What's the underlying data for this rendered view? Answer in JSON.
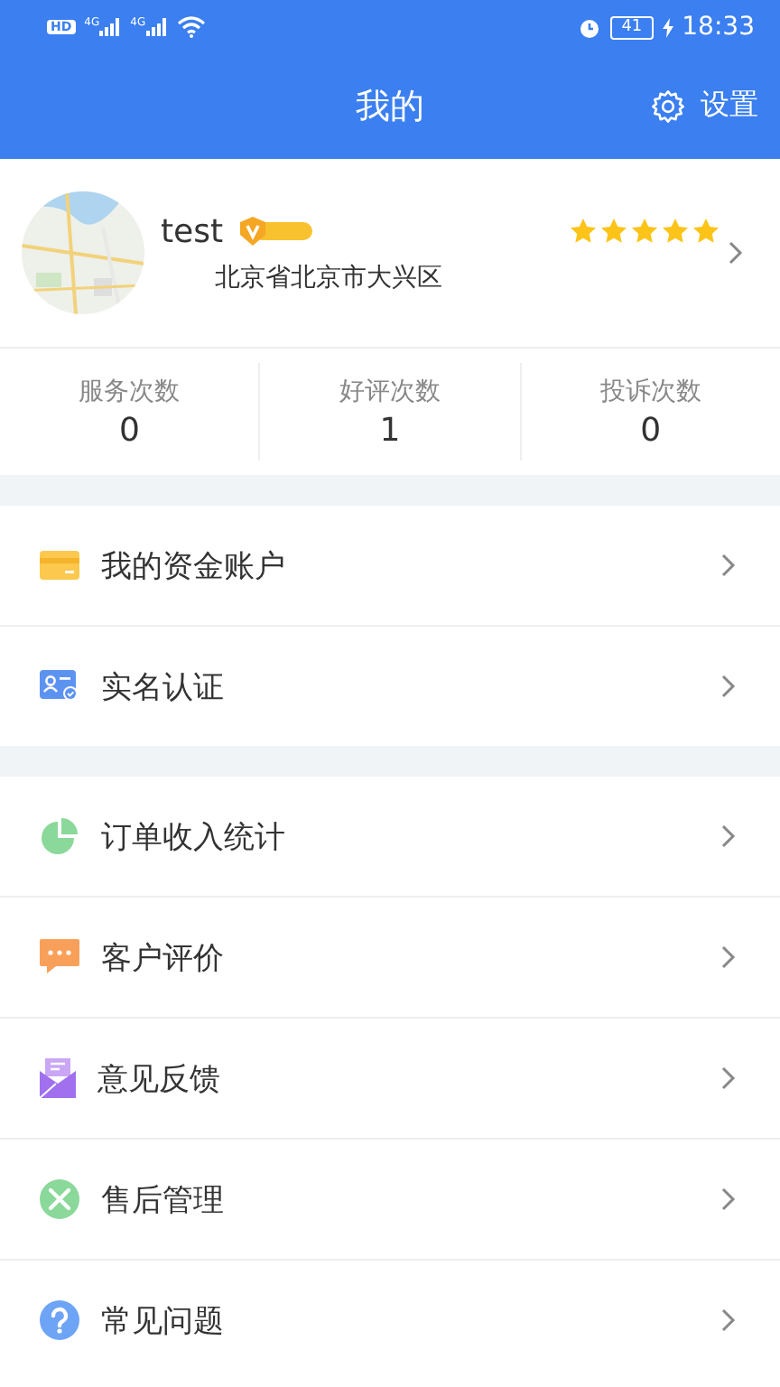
{
  "status_bar": {
    "hd": "HD",
    "signals": [
      "4G",
      "4G"
    ],
    "battery": "41",
    "time": "18:33"
  },
  "header": {
    "title": "我的",
    "settings": "设置"
  },
  "profile": {
    "name": "test",
    "verified": true,
    "stars": 5,
    "address": "北京省北京市大兴区"
  },
  "stats": [
    {
      "label": "服务次数",
      "value": "0"
    },
    {
      "label": "好评次数",
      "value": "1"
    },
    {
      "label": "投诉次数",
      "value": "0"
    }
  ],
  "menu_groups": [
    [
      {
        "kind": "wallet",
        "label": "我的资金账户"
      },
      {
        "kind": "idcard",
        "label": "实名认证"
      }
    ],
    [
      {
        "kind": "pie",
        "label": "订单收入统计"
      },
      {
        "kind": "chat",
        "label": "客户评价"
      },
      {
        "kind": "mail",
        "label": "意见反馈"
      },
      {
        "kind": "tools",
        "label": "售后管理"
      },
      {
        "kind": "help",
        "label": "常见问题"
      }
    ]
  ]
}
